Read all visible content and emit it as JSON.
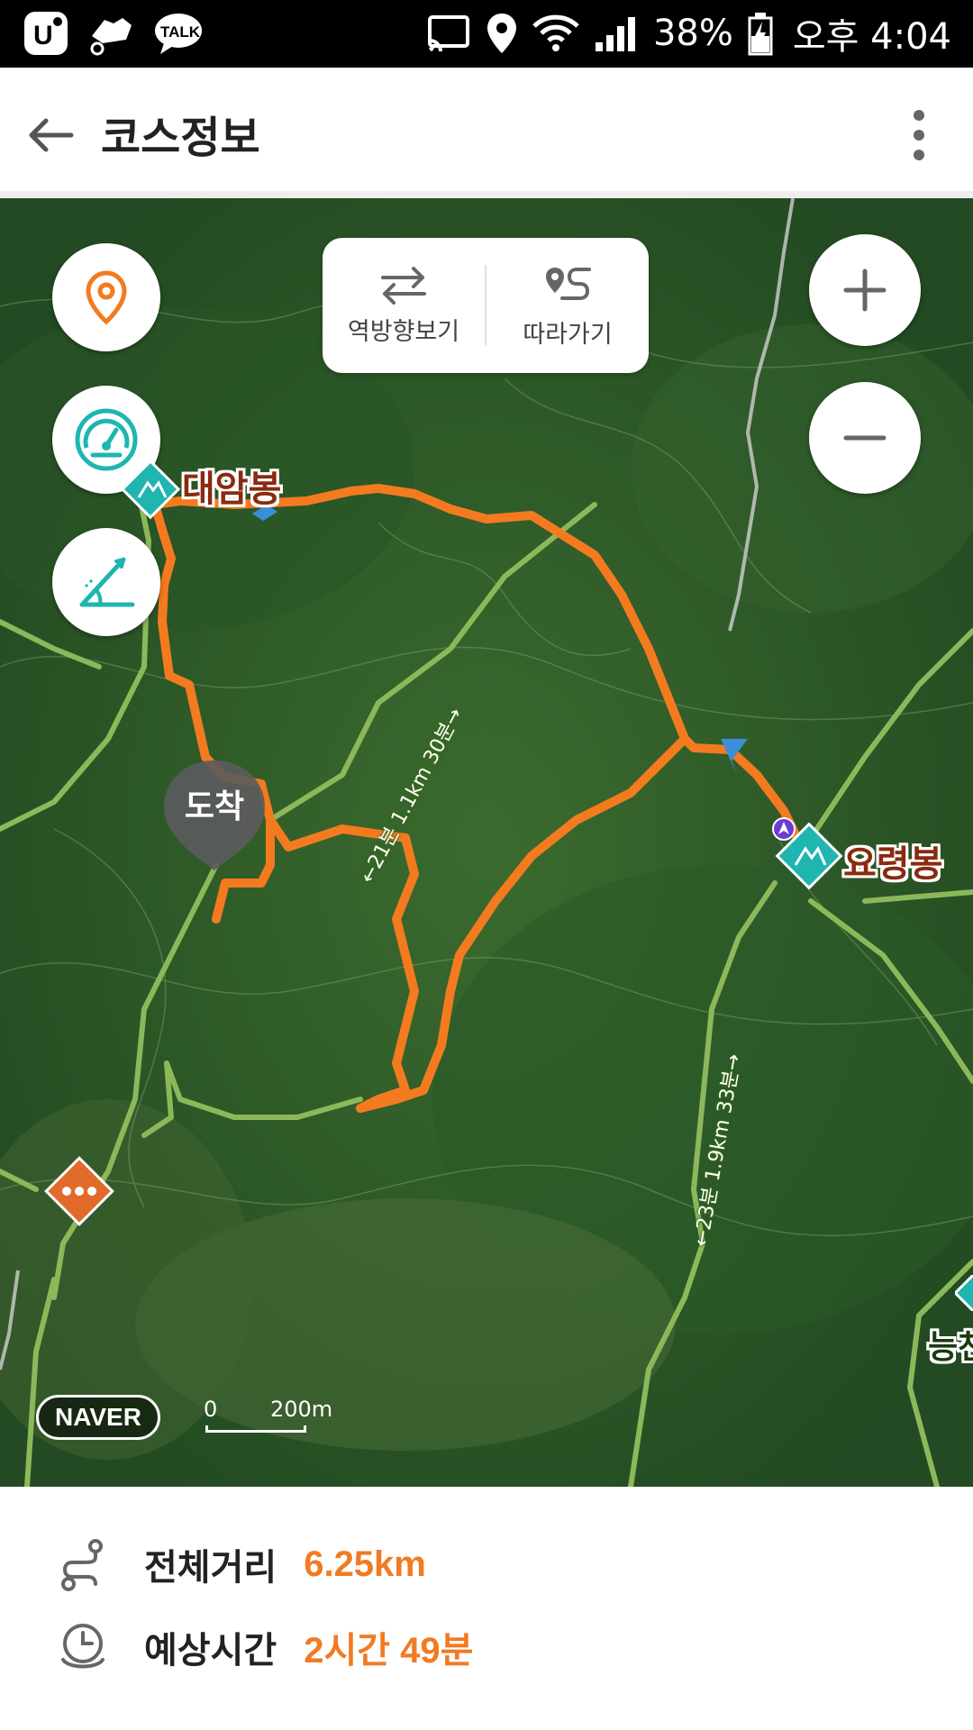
{
  "status_bar": {
    "battery": "38%",
    "time": "오후 4:04",
    "left_icons": [
      "uplus-icon",
      "sneaker-icon",
      "talk-icon"
    ],
    "talk_label": "TALK"
  },
  "app_bar": {
    "title": "코스정보"
  },
  "map": {
    "segment": {
      "reverse_label": "역방향보기",
      "follow_label": "따라가기"
    },
    "peaks": {
      "daeambong": "대암봉",
      "yoryeongbong": "요령봉",
      "neung_partial": "능천"
    },
    "trail_labels": {
      "seg1": "←21분 1.1km 30분→",
      "seg2": "←23분 1.9km 33분→"
    },
    "arrival_label": "도착",
    "brand": "NAVER",
    "scale_zero": "0",
    "scale_value": "200m",
    "colors": {
      "route": "#f47a20",
      "trail": "#8db85a",
      "accent_teal": "#1fb5b0"
    }
  },
  "info": {
    "distance_label": "전체거리",
    "distance_value": "6.25km",
    "time_label": "예상시간",
    "time_value": "2시간 49분"
  }
}
